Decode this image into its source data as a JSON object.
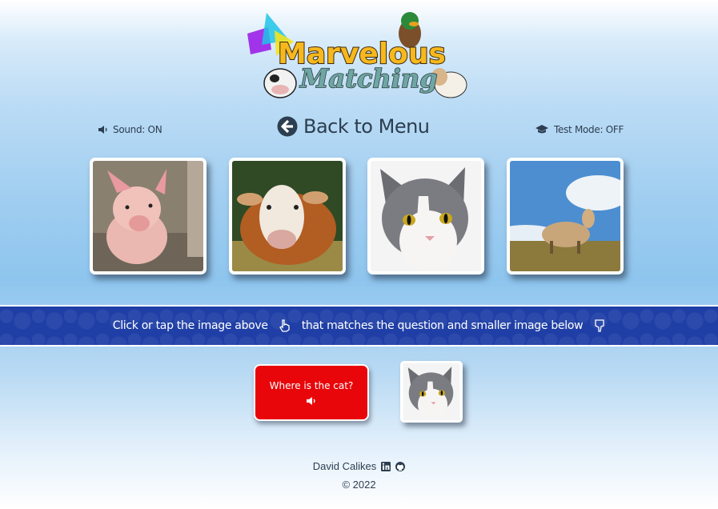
{
  "logo": {
    "line1": "Marvelous",
    "line2": "Matching"
  },
  "header": {
    "sound_label": "Sound: ON",
    "sound_icon": "speaker-icon",
    "back_label": "Back to Menu",
    "back_icon": "arrow-left-circle-icon",
    "test_label": "Test Mode: OFF",
    "test_icon": "graduation-cap-icon"
  },
  "cards": [
    {
      "animal": "pig"
    },
    {
      "animal": "cow"
    },
    {
      "animal": "cat"
    },
    {
      "animal": "sheep"
    }
  ],
  "banner": {
    "text_left": "Click or tap the image above",
    "text_right": "that matches the question and smaller image below",
    "icon_left": "hand-pointer-icon",
    "icon_right": "hand-pointer-down-icon"
  },
  "question": {
    "text": "Where is the cat?",
    "icon": "speaker-icon"
  },
  "thumbnail": {
    "animal": "cat"
  },
  "footer": {
    "name": "David Calikes",
    "icons": [
      "linkedin-icon",
      "github-icon"
    ],
    "copyright": "© 2022"
  },
  "colors": {
    "banner": "#1f3fa6",
    "question_bg": "#e8060b",
    "text": "#2c3e50"
  }
}
